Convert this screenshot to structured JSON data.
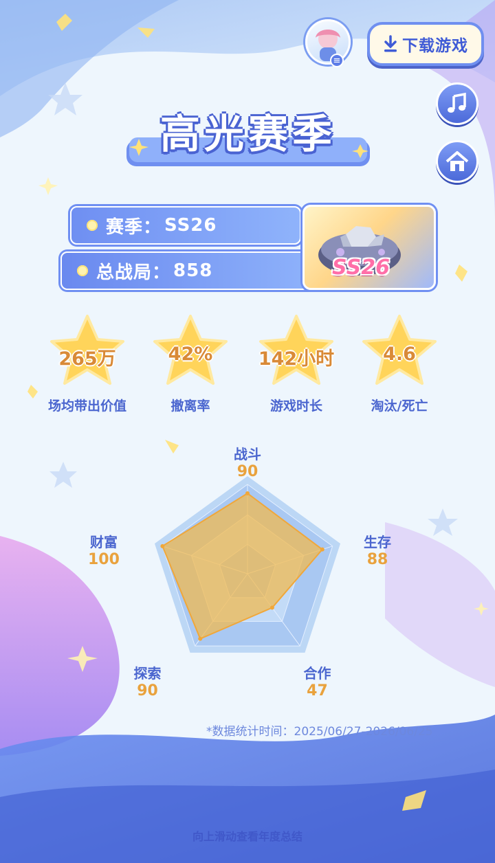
{
  "header": {
    "download_label": "下载游戏",
    "title": "高光赛季"
  },
  "season": {
    "season_label": "赛季：",
    "season_value": "SS26",
    "battles_label": "总战局：",
    "battles_value": "858",
    "emblem_text": "SS26"
  },
  "stats": [
    {
      "value": "265万",
      "label": "场均带出价值"
    },
    {
      "value": "42%",
      "label": "撤离率"
    },
    {
      "value": "142小时",
      "label": "游戏时长"
    },
    {
      "value": "4.6",
      "label": "淘汰/死亡"
    }
  ],
  "radar": {
    "axes": [
      {
        "name": "战斗",
        "value": 90
      },
      {
        "name": "生存",
        "value": 88
      },
      {
        "name": "合作",
        "value": 47
      },
      {
        "name": "探索",
        "value": 90
      },
      {
        "name": "财富",
        "value": 100
      }
    ],
    "max": 100,
    "fill_color": "#f2b94a",
    "frame_color": "#a9c8f2"
  },
  "footnote": "*数据统计时间：2025/06/27-2026/06/25",
  "scroll_hint": "向上滑动查看年度总结",
  "colors": {
    "accent": "#4b66cf",
    "value_orange": "#e9a23d",
    "star_yellow": "#ffd45a"
  },
  "icons": {
    "download": "download-icon",
    "music": "music-note-icon",
    "home": "home-icon",
    "avatar": "user-avatar"
  }
}
